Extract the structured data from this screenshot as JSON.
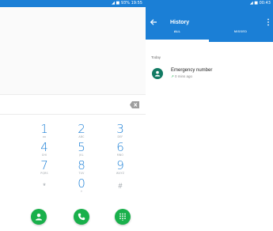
{
  "left_phone": {
    "status_text": "◢ ■ 93% 19:55",
    "keys": [
      {
        "digit": "1",
        "letters": "oo"
      },
      {
        "digit": "2",
        "letters": "ABC"
      },
      {
        "digit": "3",
        "letters": "DEF"
      },
      {
        "digit": "4",
        "letters": "GHI"
      },
      {
        "digit": "5",
        "letters": "JKL"
      },
      {
        "digit": "6",
        "letters": "MNO"
      },
      {
        "digit": "7",
        "letters": "PQRS"
      },
      {
        "digit": "8",
        "letters": "TUV"
      },
      {
        "digit": "9",
        "letters": "WXYZ"
      },
      {
        "digit": "*",
        "letters": ""
      },
      {
        "digit": "0",
        "letters": "+"
      },
      {
        "digit": "#",
        "letters": ""
      }
    ],
    "fabs": [
      "contacts-icon",
      "call-icon",
      "dialpad-icon"
    ],
    "accent": "#1b7fd6",
    "fab_color": "#19b04b"
  },
  "right_phone": {
    "status_text": "◢ ■ 00:43",
    "title": "History",
    "tabs": [
      {
        "label": "ALL",
        "active": true
      },
      {
        "label": "MISSED",
        "active": false
      }
    ],
    "section": "Today",
    "entries": [
      {
        "name": "Emergency number",
        "time": "0 mins ago",
        "direction": "outgoing"
      }
    ],
    "accent": "#1b7fd6",
    "avatar_color": "#127a63"
  }
}
